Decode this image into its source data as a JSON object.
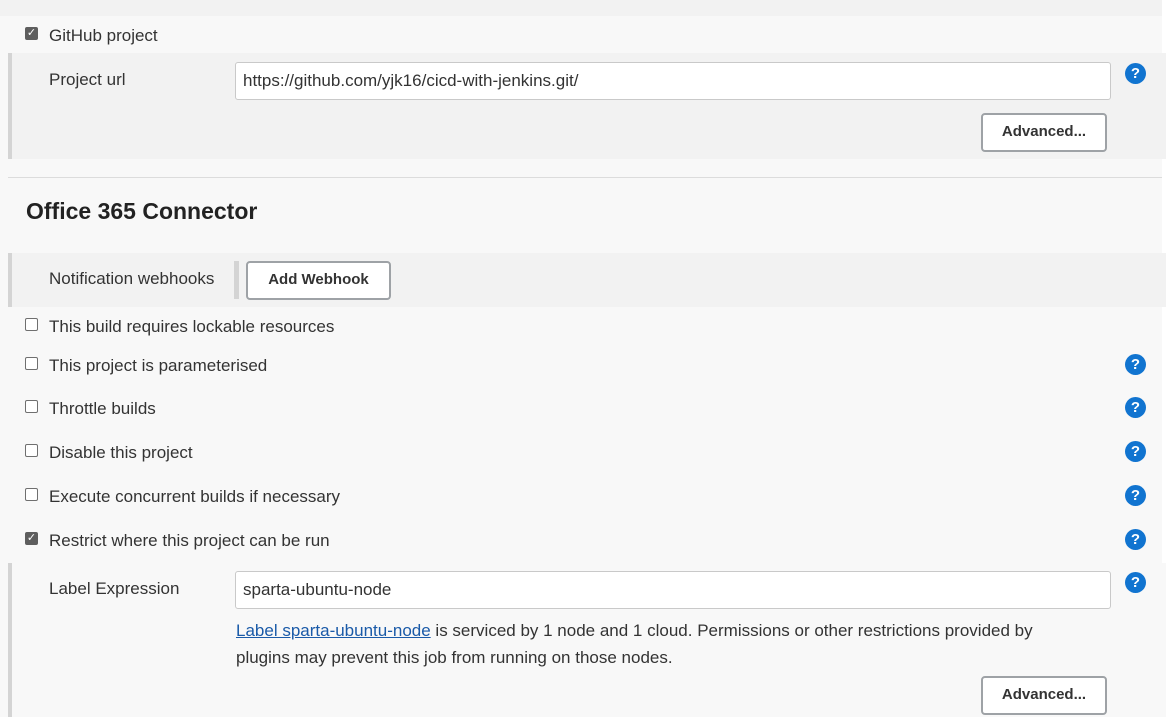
{
  "github_project": {
    "checkbox_label": "GitHub project",
    "checked": true,
    "project_url_label": "Project url",
    "project_url_value": "https://github.com/yjk16/cicd-with-jenkins.git/",
    "advanced_label": "Advanced..."
  },
  "office365": {
    "title": "Office 365 Connector",
    "webhooks_label": "Notification webhooks",
    "add_webhook_label": "Add Webhook"
  },
  "options": [
    {
      "label": "This build requires lockable resources",
      "checked": false
    },
    {
      "label": "This project is parameterised",
      "checked": false
    },
    {
      "label": "Throttle builds",
      "checked": false
    },
    {
      "label": "Disable this project",
      "checked": false
    },
    {
      "label": "Execute concurrent builds if necessary",
      "checked": false
    },
    {
      "label": "Restrict where this project can be run",
      "checked": true
    }
  ],
  "restrict": {
    "label_expression_label": "Label Expression",
    "label_expression_value": "sparta-ubuntu-node",
    "info_link": "Label sparta-ubuntu-node",
    "info_line1_rest": " is serviced by 1 node and 1 cloud. Permissions or other restrictions provided by",
    "info_line2": "plugins may prevent this job from running on those nodes.",
    "advanced_label": "Advanced..."
  },
  "help_glyph": "?",
  "check_glyph": "✓",
  "colors": {
    "help_icon": "#1174d0",
    "link": "#1a5aa8",
    "checkbox_checked": "#5e5e5e"
  }
}
